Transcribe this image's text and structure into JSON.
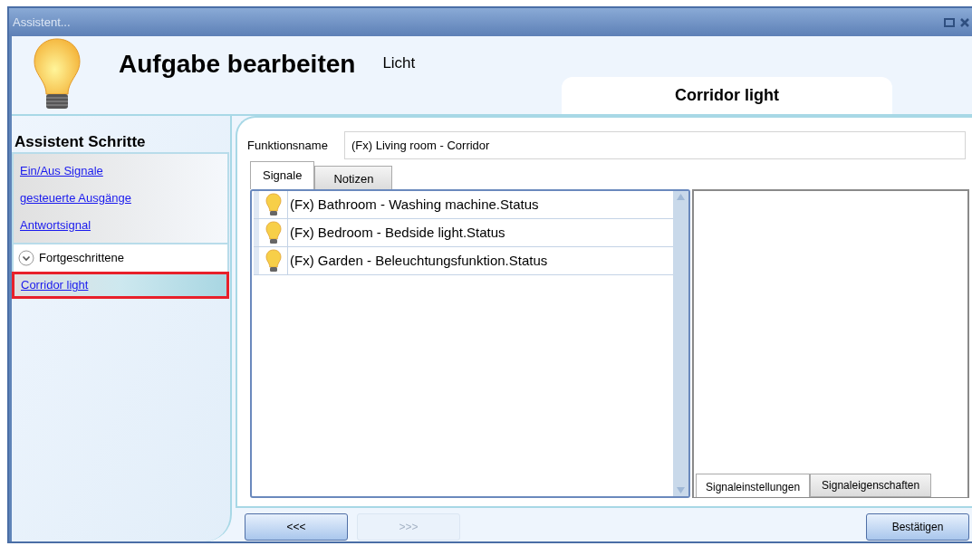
{
  "window": {
    "title": "Assistent..."
  },
  "header": {
    "title": "Aufgabe bearbeiten",
    "subtitle": "Licht",
    "tab": "Corridor light"
  },
  "sidebar": {
    "heading": "Assistent Schritte",
    "steps": [
      {
        "label": "Ein/Aus Signale",
        "selected": false
      },
      {
        "label": "gesteuerte Ausgänge",
        "selected": false
      },
      {
        "label": "Antwortsignal",
        "selected": false
      }
    ],
    "group": {
      "label": "Fortgeschrittene",
      "expanded": true,
      "children": [
        {
          "label": "Corridor light",
          "selected": true
        }
      ]
    }
  },
  "form": {
    "label": "Funktionsname",
    "value": "(Fx) Living room - Corridor"
  },
  "tabs": [
    {
      "label": "Signale",
      "selected": true
    },
    {
      "label": "Notizen",
      "selected": false
    }
  ],
  "signals": [
    {
      "label": "(Fx) Bathroom - Washing machine.Status"
    },
    {
      "label": "(Fx) Bedroom - Bedside light.Status"
    },
    {
      "label": "(Fx) Garden - Beleuchtungsfunktion.Status"
    }
  ],
  "detail_tabs": [
    {
      "label": "Signaleinstellungen",
      "selected": true
    },
    {
      "label": "Signaleigenschaften",
      "selected": false
    }
  ],
  "buttons": [
    {
      "label": "<<<",
      "disabled": false
    },
    {
      "label": ">>>",
      "disabled": true
    },
    {
      "label": "Bestätigen",
      "disabled": false
    }
  ]
}
